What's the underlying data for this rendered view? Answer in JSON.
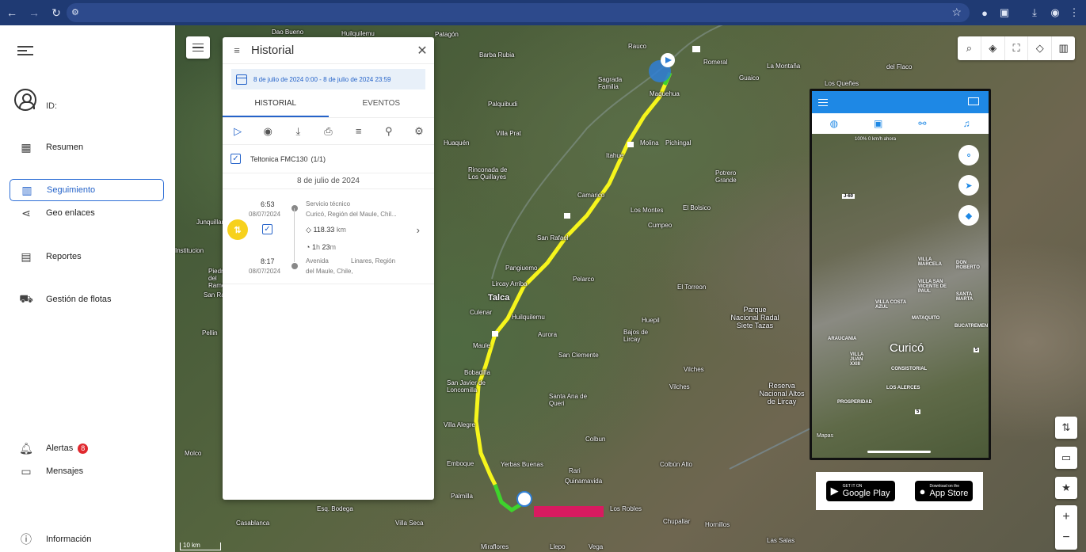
{
  "browser": {
    "site_icon": "tune-icon"
  },
  "sidebar": {
    "id_label": "ID:",
    "items": [
      {
        "label": "Resumen",
        "icon": "dashboard-icon"
      },
      {
        "label": "Seguimiento",
        "icon": "map-icon",
        "active": true
      },
      {
        "label": "Geo enlaces",
        "icon": "share-icon"
      },
      {
        "label": "Reportes",
        "icon": "chart-icon"
      },
      {
        "label": "Gestión de flotas",
        "icon": "car-icon"
      },
      {
        "label": "Alertas",
        "icon": "bell-icon",
        "badge": "8"
      },
      {
        "label": "Mensajes",
        "icon": "message-icon"
      },
      {
        "label": "Información",
        "icon": "help-icon"
      }
    ]
  },
  "panel": {
    "title": "Historial",
    "date_range": "8 de julio de 2024 0:00 - 8 de julio de 2024 23:59",
    "tabs": [
      "HISTORIAL",
      "EVENTOS"
    ],
    "device": "Teltonica FMC130",
    "device_count": "(1/1)",
    "day": "8 de julio de 2024",
    "trip": {
      "start_time": "6:53",
      "start_date": "08/07/2024",
      "start_name": "Servicio técnico",
      "start_addr": "Curicó, Región del Maule, Chil...",
      "distance": "118.33",
      "distance_unit": "km",
      "duration_h": "1",
      "duration_h_unit": "h",
      "duration_m": "23",
      "duration_m_unit": "m",
      "end_time": "8:17",
      "end_date": "08/07/2024",
      "end_addr_1": "Avenida",
      "end_addr_2": "Linares, Región",
      "end_addr_3": "del Maule, Chile,"
    }
  },
  "map": {
    "scale": "10 km",
    "places": [
      {
        "n": "Dao Bueno"
      },
      {
        "n": "Huilquilemu"
      },
      {
        "n": "Patagón"
      },
      {
        "n": "Barba Rubia"
      },
      {
        "n": "Rauco"
      },
      {
        "n": "Romeral"
      },
      {
        "n": "La Montaña"
      },
      {
        "n": "Guaico"
      },
      {
        "n": "Los Queñes"
      },
      {
        "n": "del Flaco"
      },
      {
        "n": "Sagrada Familia"
      },
      {
        "n": "Maquehua"
      },
      {
        "n": "Palquibudi"
      },
      {
        "n": "Villa Prat"
      },
      {
        "n": "Huaquén"
      },
      {
        "n": "Rinconada de Los Quillayes"
      },
      {
        "n": "Molina"
      },
      {
        "n": "Pichingal"
      },
      {
        "n": "Itahue"
      },
      {
        "n": "Potrero Grande"
      },
      {
        "n": "Camarico"
      },
      {
        "n": "Los Montes"
      },
      {
        "n": "El Bolsico"
      },
      {
        "n": "Cumpeo"
      },
      {
        "n": "San Rafael"
      },
      {
        "n": "Junquillar"
      },
      {
        "n": "Pangiuemo"
      },
      {
        "n": "Pelarco"
      },
      {
        "n": "Lircay Arriba"
      },
      {
        "n": "El Torreon"
      },
      {
        "n": "Talca"
      },
      {
        "n": "Parque Nacional Radal Siete Tazas"
      },
      {
        "n": "Culenar"
      },
      {
        "n": "Huilquilemu"
      },
      {
        "n": "Huepil"
      },
      {
        "n": "Aurora"
      },
      {
        "n": "Bajos de Lircay"
      },
      {
        "n": "Maule"
      },
      {
        "n": "San Clemente"
      },
      {
        "n": "Pellin"
      },
      {
        "n": "Bobadilla"
      },
      {
        "n": "Vilches"
      },
      {
        "n": "San Javier de Loncomilla"
      },
      {
        "n": "Vilches"
      },
      {
        "n": "Santa Ana de Queri"
      },
      {
        "n": "Reserva Nacional Altos de Lircay"
      },
      {
        "n": "Villa Alegre"
      },
      {
        "n": "Colbun"
      },
      {
        "n": "Molco"
      },
      {
        "n": "Emboque"
      },
      {
        "n": "Yerbas Buenas"
      },
      {
        "n": "Colbún Alto"
      },
      {
        "n": "Rari"
      },
      {
        "n": "Quinamavida"
      },
      {
        "n": "Palmilla"
      },
      {
        "n": "Esq. Bodega"
      },
      {
        "n": "Los Robles"
      },
      {
        "n": "Casablanca"
      },
      {
        "n": "Villa Seca"
      },
      {
        "n": "Chupallar"
      },
      {
        "n": "Hornillos"
      },
      {
        "n": "Miraflores"
      },
      {
        "n": "Llepo"
      },
      {
        "n": "Vega"
      },
      {
        "n": "Las Salas"
      },
      {
        "n": "Piedra del Ramos"
      },
      {
        "n": "San Ramon"
      },
      {
        "n": "Institucion"
      }
    ]
  },
  "phone": {
    "status": "100%   0 km/h   ahora",
    "city": "Curicó",
    "route_j60": "J-60",
    "route_5": "5",
    "attribution": "Mapas",
    "labels": [
      "VILLA MARCELA",
      "DON ROBERTO",
      "VILLA SAN VICENTE DE PAUL",
      "SANTA MARTA",
      "VILLA COSTA AZUL",
      "MATAQUITO",
      "BUCATREMEN",
      "ARAUCANIA",
      "VILLA JUAN XXIII",
      "CONSISTORIAL",
      "LOS ALERCES",
      "PROSPERIDAD"
    ]
  },
  "stores": {
    "google_small": "GET IT ON",
    "google_large": "Google Play",
    "apple_small": "Download on the",
    "apple_large": "App Store"
  },
  "colors": {
    "accent": "#2563c9",
    "route_yellow": "#f6f51c",
    "route_green": "#3ed32c",
    "badge_red": "#e0282e",
    "marker_pink": "#d81b60"
  }
}
